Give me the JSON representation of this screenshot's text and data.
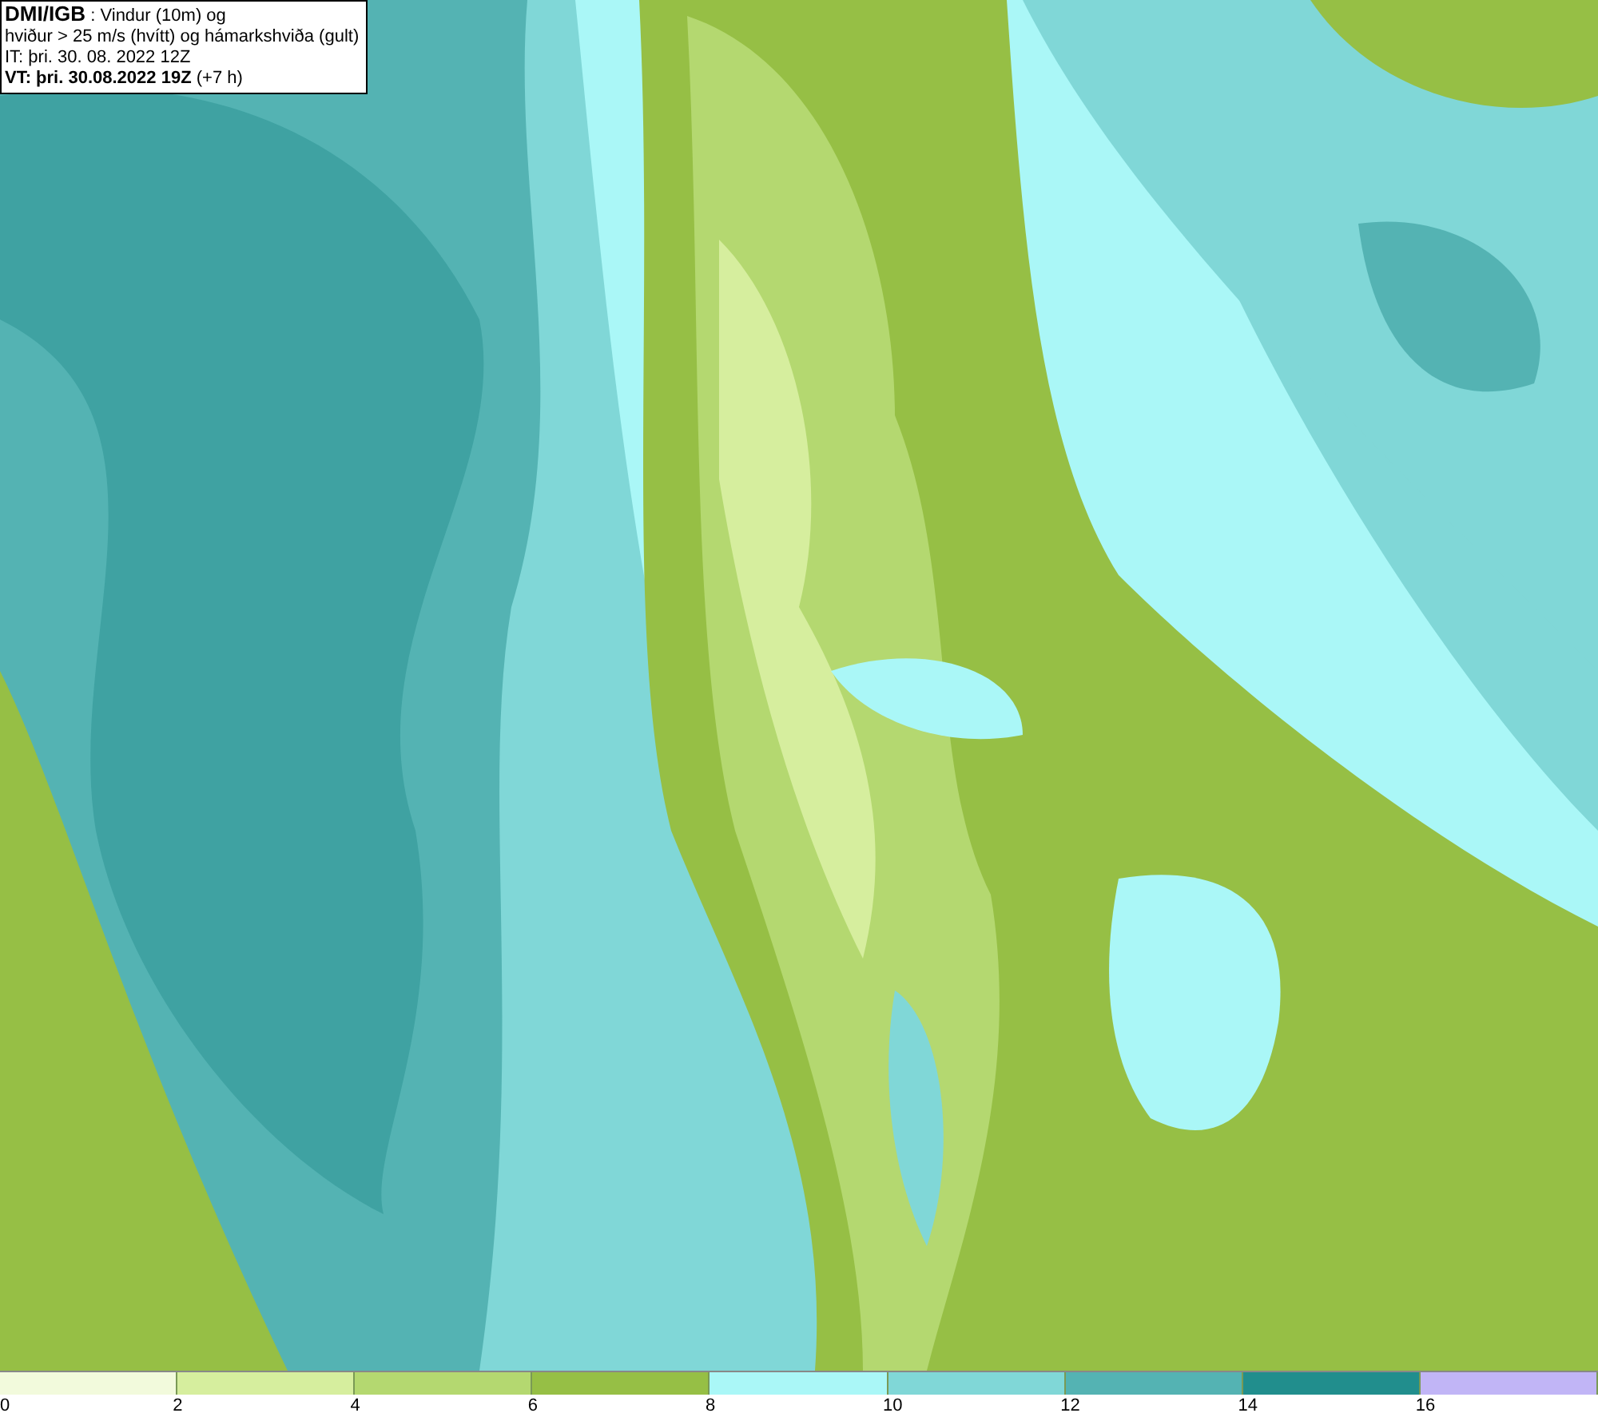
{
  "header": {
    "lines": [
      "**DMI/IGB** : Vindur (10m) og",
      "hviður > 25 m/s (hvítt) og hámarkshviða (gult)",
      "IT: þri. 30. 08. 2022 12Z",
      "**VT: þri. 30.08.2022 19Z** (+7 h)"
    ]
  },
  "legend": {
    "bins": [
      {
        "label": "0",
        "color": "#f2fadc"
      },
      {
        "label": "2",
        "color": "#d6ee9e"
      },
      {
        "label": "4",
        "color": "#b4d870"
      },
      {
        "label": "6",
        "color": "#96bf45"
      },
      {
        "label": "8",
        "color": "#aaf7f7"
      },
      {
        "label": "10",
        "color": "#80d7d7"
      },
      {
        "label": "12",
        "color": "#54b3b3"
      },
      {
        "label": "14",
        "color": "#218e8d"
      },
      {
        "label": "16",
        "color": "#c1b5f6"
      }
    ]
  }
}
